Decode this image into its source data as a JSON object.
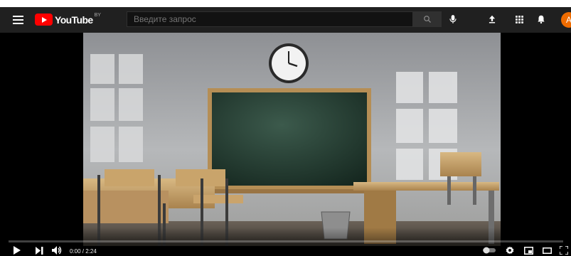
{
  "header": {
    "logo_text": "YouTube",
    "country_code": "BY",
    "search_placeholder": "Введите запрос",
    "avatar_letter": "A"
  },
  "player": {
    "current_time": "0:00",
    "duration": "2:24",
    "time_display": "0:00 / 2:24",
    "progress": 0.0
  },
  "colors": {
    "brand": "#ff0000",
    "topbar": "#202020",
    "avatar": "#ef6c00"
  }
}
